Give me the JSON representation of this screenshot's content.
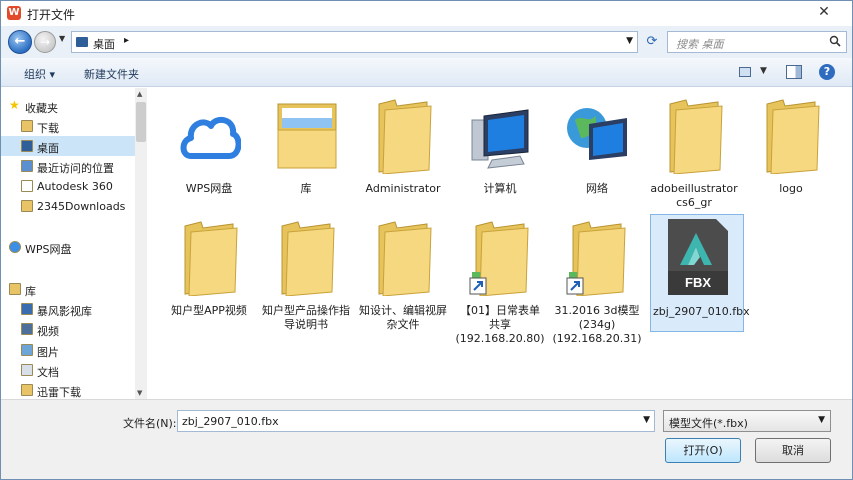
{
  "window": {
    "title": "打开文件",
    "close_glyph": "✕"
  },
  "address": {
    "location": "桌面",
    "search_placeholder": "搜索 桌面"
  },
  "toolbar": {
    "organize_label": "组织 ▾",
    "new_folder_label": "新建文件夹"
  },
  "sidebar": {
    "items": [
      {
        "label": "收藏夹",
        "icon": "star-icon"
      },
      {
        "label": "下载",
        "icon": "download-folder-icon"
      },
      {
        "label": "桌面",
        "icon": "desktop-icon",
        "selected": true
      },
      {
        "label": "最近访问的位置",
        "icon": "recent-places-icon"
      },
      {
        "label": "Autodesk 360",
        "icon": "document-icon"
      },
      {
        "label": "2345Downloads",
        "icon": "folder-icon"
      },
      {
        "label": "WPS网盘",
        "icon": "cloud-icon"
      },
      {
        "label": "库",
        "icon": "library-icon"
      },
      {
        "label": "暴风影视库",
        "icon": "video-library-icon"
      },
      {
        "label": "视频",
        "icon": "video-icon"
      },
      {
        "label": "图片",
        "icon": "pictures-icon"
      },
      {
        "label": "文档",
        "icon": "documents-icon"
      },
      {
        "label": "迅雷下载",
        "icon": "thunder-download-icon"
      }
    ]
  },
  "files": [
    {
      "name": "WPS网盘",
      "icon": "cloud-icon"
    },
    {
      "name": "库",
      "icon": "library-folder-icon"
    },
    {
      "name": "Administrator",
      "icon": "user-folder-icon"
    },
    {
      "name": "计算机",
      "icon": "computer-icon"
    },
    {
      "name": "网络",
      "icon": "network-icon"
    },
    {
      "name": "adobeillustrator cs6_gr",
      "icon": "folder-icon"
    },
    {
      "name": "logo",
      "icon": "folder-icon"
    },
    {
      "name": "知户型APP视频",
      "icon": "folder-icon"
    },
    {
      "name": "知户型产品操作指导说明书",
      "icon": "folder-icon"
    },
    {
      "name": "知设计、编辑视屏杂文件",
      "icon": "folder-icon"
    },
    {
      "name": "【01】日常表单共享 (192.168.20.80)",
      "icon": "network-folder-shortcut-icon"
    },
    {
      "name": "31.2016 3d模型(234g) (192.168.20.31)",
      "icon": "network-folder-shortcut-icon"
    },
    {
      "name": "zbj_2907_010.fbx",
      "icon": "fbx-file-icon",
      "selected": true
    }
  ],
  "fbx_badge": "FBX",
  "footer": {
    "filename_label": "文件名(N):",
    "filename_value": "zbj_2907_010.fbx",
    "filetype_value": "模型文件(*.fbx)",
    "open_label": "打开(O)",
    "cancel_label": "取消"
  }
}
